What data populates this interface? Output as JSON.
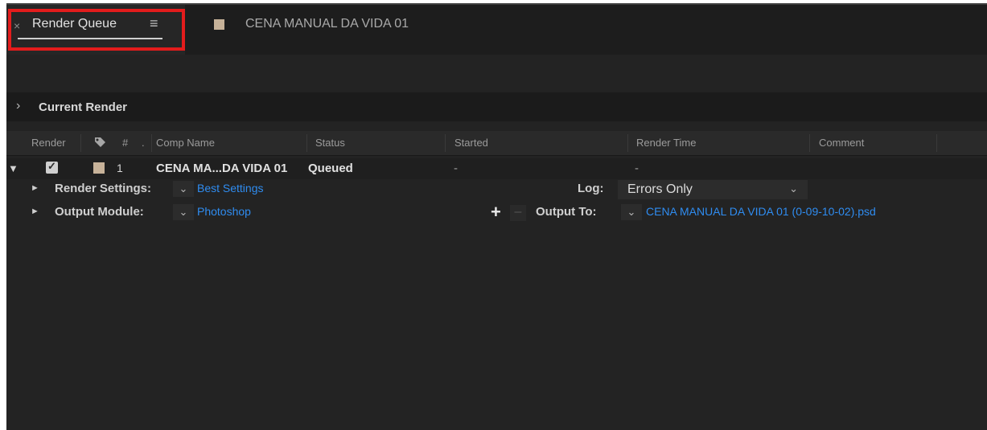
{
  "tabs": {
    "render_queue": {
      "close": "×",
      "title": "Render Queue",
      "menu": "≡"
    },
    "comp": {
      "title": "CENA MANUAL DA VIDA 01",
      "swatch_color": "#c7b299"
    }
  },
  "current_render": {
    "chevron": "›",
    "label": "Current Render"
  },
  "columns": {
    "render": "Render",
    "hash": "#",
    "dot": ".",
    "comp_name": "Comp Name",
    "status": "Status",
    "started": "Started",
    "render_time": "Render Time",
    "comment": "Comment"
  },
  "item": {
    "twisty": "▼",
    "checked": "✓",
    "number": "1",
    "comp_name": "CENA MA...DA VIDA 01",
    "status": "Queued",
    "started": "-",
    "render_time": "-"
  },
  "render_settings": {
    "label": "Render Settings:",
    "value": "Best Settings",
    "log_label": "Log:",
    "log_value": "Errors Only"
  },
  "output_module": {
    "label": "Output Module:",
    "value": "Photoshop",
    "add": "+",
    "remove": "–",
    "output_to_label": "Output To:",
    "output_to_value": "CENA MANUAL DA VIDA 01 (0-09-10-02).psd"
  },
  "icons": {
    "twisty_right": "►",
    "dropdown": "⌄",
    "tag": "tag-icon"
  },
  "colors": {
    "link": "#2f8cf0",
    "highlight": "#e31c1c",
    "label": "#c7b299"
  }
}
